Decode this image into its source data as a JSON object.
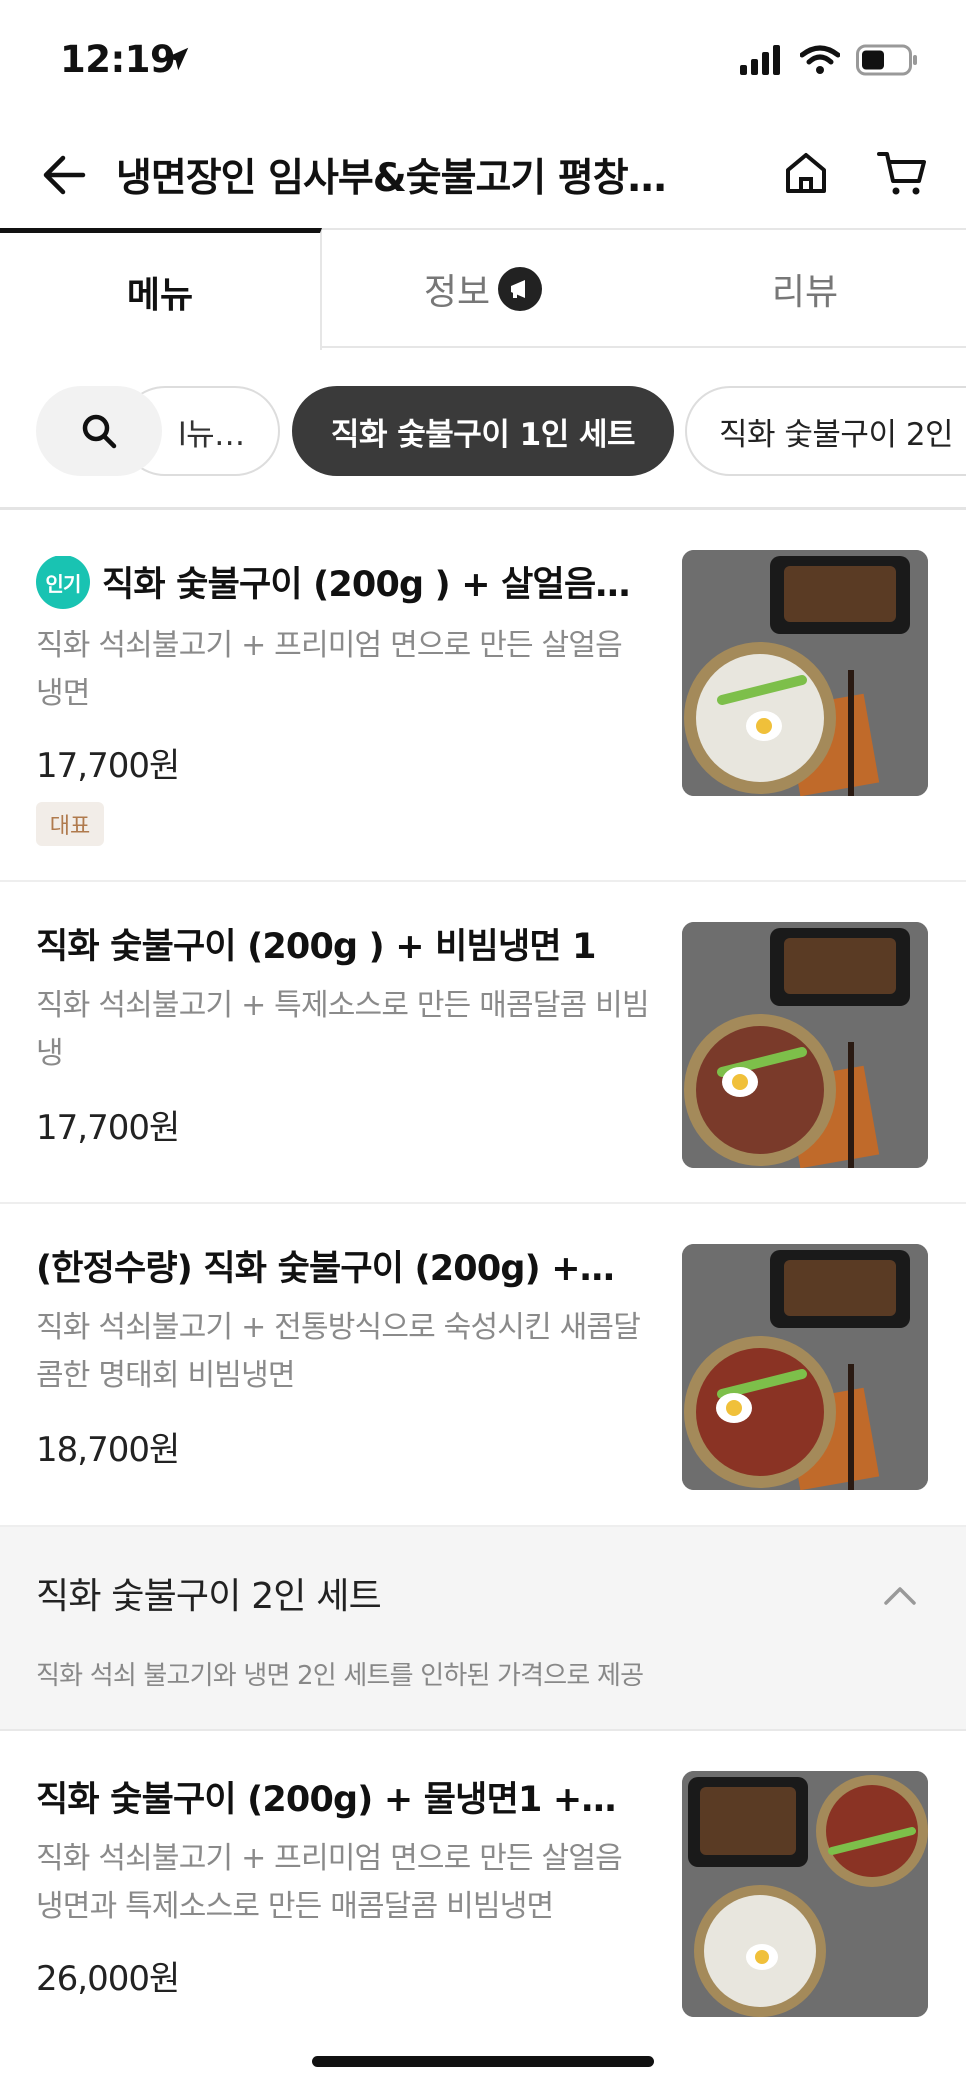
{
  "status_bar": {
    "time": "12:19"
  },
  "header": {
    "title": "냉면장인 임사부&숯불고기 평창…"
  },
  "tabs": {
    "menu": "메뉴",
    "info": "정보",
    "review": "리뷰"
  },
  "chips": [
    "l뉴…",
    "직화 숯불구이 1인 세트",
    "직화 숯불구이 2인"
  ],
  "menu_items": [
    {
      "badge": "인기",
      "name": "직화 숯불구이 (200g ) + 살얼음…",
      "desc": "직화 석쇠불고기 + 프리미엄 면으로 만든 살얼음 냉면",
      "price": "17,700원",
      "tag": "대표"
    },
    {
      "name": "직화 숯불구이 (200g ) + 비빔냉면 1",
      "desc": "직화 석쇠불고기 +  특제소스로 만든 매콤달콤 비빔냉",
      "price": "17,700원"
    },
    {
      "name": "(한정수량) 직화 숯불구이 (200g) +…",
      "desc": "직화 석쇠불고기 + 전통방식으로 숙성시킨 새콤달콤한 명태회 비빔냉면",
      "price": "18,700원"
    }
  ],
  "section": {
    "title": "직화 숯불구이 2인 세트",
    "desc": "직화 석쇠 불고기와 냉면 2인 세트를 인하된 가격으로 제공"
  },
  "section_items": [
    {
      "name": "직화 숯불구이 (200g) + 물냉면1 +…",
      "desc": "직화 석쇠불고기 + 프리미엄 면으로 만든 살얼음 냉면과 특제소스로 만든 매콤달콤 비빔냉면",
      "price": "26,000원"
    }
  ],
  "colors": {
    "popular_badge": "#19c3b2",
    "selected_chip": "#3a3a3a",
    "rep_badge_text": "#b07a4d"
  }
}
